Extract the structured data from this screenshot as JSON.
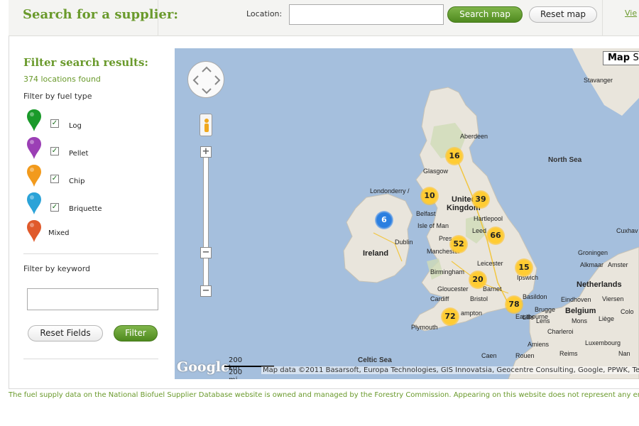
{
  "header": {
    "title": "Search for a supplier:",
    "location_label": "Location:",
    "location_value": "",
    "search_button": "Search map",
    "reset_button": "Reset map",
    "view_link": "Vie"
  },
  "sidebar": {
    "title": "Filter search results:",
    "locations_found": "374 locations found",
    "fuel_heading": "Filter by fuel type",
    "fuels": [
      {
        "label": "Log",
        "checked": true,
        "color": "#1a9a2a"
      },
      {
        "label": "Pellet",
        "checked": true,
        "color": "#9b3fb5"
      },
      {
        "label": "Chip",
        "checked": true,
        "color": "#f29a1c"
      },
      {
        "label": "Briquette",
        "checked": true,
        "color": "#2ba3d8"
      },
      {
        "label": "Mixed",
        "checked": false,
        "color": "#e05a2b"
      }
    ],
    "keyword_heading": "Filter by keyword",
    "keyword_value": "",
    "reset_fields_button": "Reset Fields",
    "filter_button": "Filter"
  },
  "map": {
    "map_type_label": "Map",
    "map_type_label_2": "S",
    "clusters": [
      {
        "count": "16",
        "color": "yellow"
      },
      {
        "count": "10",
        "color": "yellow"
      },
      {
        "count": "39",
        "color": "yellow"
      },
      {
        "count": "6",
        "color": "blue"
      },
      {
        "count": "66",
        "color": "yellow"
      },
      {
        "count": "52",
        "color": "yellow"
      },
      {
        "count": "15",
        "color": "yellow"
      },
      {
        "count": "20",
        "color": "yellow"
      },
      {
        "count": "78",
        "color": "yellow"
      },
      {
        "count": "72",
        "color": "yellow"
      }
    ],
    "places": {
      "aberdeen": "Aberdeen",
      "glasgow": "Glasgow",
      "londonderry": "Londonderry /",
      "belfast": "Belfast",
      "united_kingdom_1": "United",
      "united_kingdom_2": "Kingdom",
      "isle_of_man": "Isle of Man",
      "hartlepool": "Hartlepool",
      "leeds": "Leed",
      "dublin": "Dublin",
      "ireland": "Ireland",
      "preston": "Pres",
      "manchester": "Manchester",
      "birmingham": "Birmingham",
      "leicester": "Leicester",
      "gloucester": "Gloucester",
      "barnet": "Barnet",
      "cardiff": "Cardiff",
      "bristol": "Bristol",
      "basildon": "Basildon",
      "ipswich": "Ipswich",
      "southampton": "ampton",
      "eastbourne": "Eastbourne",
      "plymouth": "Plymouth",
      "stavanger": "Stavanger",
      "north_sea": "North Sea",
      "cuxhaven": "Cuxhav",
      "groningen": "Groningen",
      "netherlands": "Netherlands",
      "eindhoven": "Eindhoven",
      "belgium": "Belgium",
      "charleroi": "Charleroi",
      "luxembourg": "Luxembourg",
      "amiens": "Amiens",
      "reims": "Reims",
      "caen": "Caen",
      "rouen": "Rouen",
      "celtic_sea": "Celtic Sea",
      "brugge": "Brugge",
      "alkmaar": "Alkmaar",
      "amsterdam": "Amster",
      "lille": "Lille",
      "liege": "Liège",
      "cologne": "Colo",
      "viersen": "Viersen",
      "lens": "Lens",
      "mons": "Mons",
      "nancy": "Nan"
    },
    "scale_km": "200 km",
    "scale_mi": "200 mi",
    "google_logo": "Google",
    "attribution": "Map data ©2011 Basarsoft, Europa Technologies, GIS Innovatsia, Geocentre Consulting, Google, PPWK, Tele Atlas"
  },
  "footer": {
    "text": "The fuel supply data on the National Biofuel Supplier Database website is owned and managed by the Forestry Commission. Appearing on this website does not represent any endorse"
  }
}
